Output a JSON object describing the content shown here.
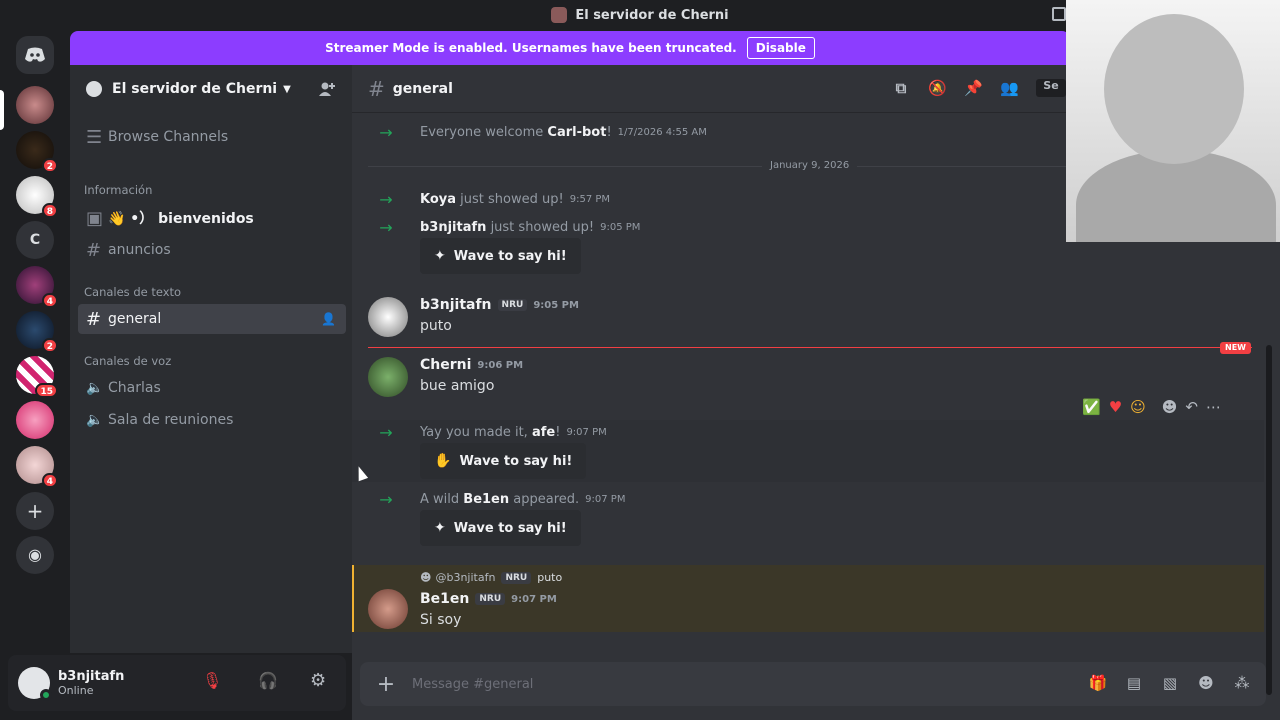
{
  "window": {
    "title": "El servidor de Cherni"
  },
  "banner": {
    "text": "Streamer Mode is enabled. Usernames have been truncated.",
    "button": "Disable"
  },
  "guilds": [
    {
      "badge": ""
    },
    {
      "badge": "2"
    },
    {
      "badge": "8"
    },
    {
      "label": "C"
    },
    {
      "badge": "4"
    },
    {
      "badge": "2"
    },
    {
      "badge": "15"
    },
    {
      "badge": ""
    },
    {
      "badge": "4"
    }
  ],
  "sidebar": {
    "server_name": "El servidor de Cherni",
    "browse": "Browse Channels",
    "cat_info": "Información",
    "chan_bienvenidos": "👋 •） bienvenidos",
    "chan_anuncios": "anuncios",
    "cat_texto": "Canales de texto",
    "chan_general": "general",
    "cat_voz": "Canales de voz",
    "chan_charlas": "Charlas",
    "chan_reuniones": "Sala de reuniones"
  },
  "user": {
    "name": "b3njitafn",
    "status": "Online"
  },
  "chat": {
    "channel": "general",
    "search_placeholder": "Se",
    "sys1": {
      "pre": "Everyone welcome",
      "name": "Carl-bot",
      "post": "!",
      "time": "1/7/2026 4:55 AM"
    },
    "divider": "January 9, 2026",
    "sys2": {
      "name": "Koya",
      "post": "just showed up!",
      "time": "9:57 PM"
    },
    "sys3": {
      "name": "b3njitafn",
      "post": "just showed up!",
      "time": "9:05 PM"
    },
    "wave_label": "Wave to say hi!",
    "msg1": {
      "author": "b3njitafn",
      "tag": "NRU",
      "time": "9:05 PM",
      "text": "puto"
    },
    "new_label": "NEW",
    "msg2": {
      "author": "Cherni",
      "time": "9:06 PM",
      "text": "bue amigo"
    },
    "sys4": {
      "pre": "Yay you made it,",
      "name": "afe",
      "post": "!",
      "time": "9:07 PM"
    },
    "sys5": {
      "pre": "A wild",
      "name": "Be1en",
      "post": "appeared.",
      "time": "9:07 PM"
    },
    "reply": {
      "author": "@b3njitafn",
      "tag": "NRU",
      "text": "puto"
    },
    "msg3": {
      "author": "Be1en",
      "tag": "NRU",
      "time": "9:07 PM",
      "text": "Si soy"
    },
    "composer_placeholder": "Message #general"
  }
}
